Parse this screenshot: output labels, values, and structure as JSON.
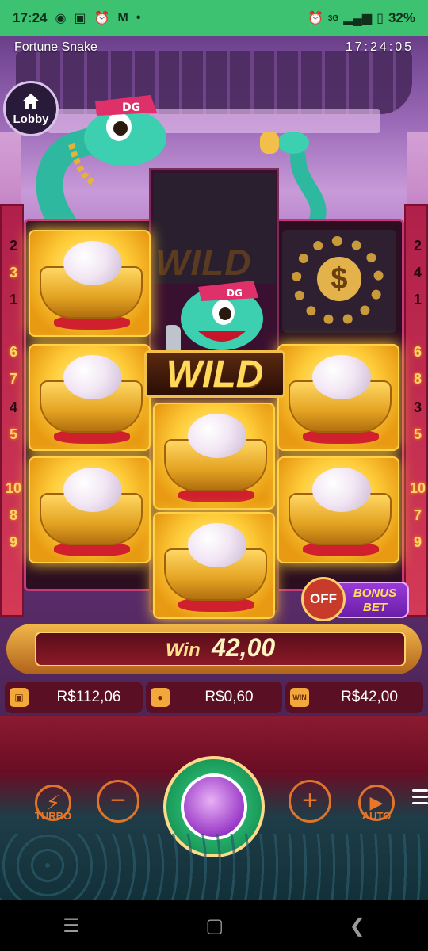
{
  "status_bar": {
    "time": "17:24",
    "left_icons": [
      "chat-icon",
      "s-app-icon",
      "alarm-icon",
      "gmail-icon",
      "dot-icon"
    ],
    "right_icons": [
      "alarm-icon",
      "signal-icon",
      "battery-icon"
    ],
    "network": "3G",
    "battery": "32%"
  },
  "game": {
    "title": "Fortune Snake",
    "clock": "17:24:05",
    "lobby_label": "Lobby",
    "wild_ghost_text": "WILD",
    "wild_text": "WILD",
    "chain_symbol_text": "$",
    "left_ways": [
      {
        "value": "2",
        "lit": false
      },
      {
        "value": "3",
        "lit": true
      },
      {
        "value": "1",
        "lit": false
      },
      {
        "value": "6",
        "lit": true
      },
      {
        "value": "7",
        "lit": true
      },
      {
        "value": "4",
        "lit": false
      },
      {
        "value": "5",
        "lit": true
      },
      {
        "value": "10",
        "lit": true
      },
      {
        "value": "8",
        "lit": true
      },
      {
        "value": "9",
        "lit": true
      }
    ],
    "right_ways": [
      {
        "value": "2",
        "lit": false
      },
      {
        "value": "4",
        "lit": false
      },
      {
        "value": "1",
        "lit": false
      },
      {
        "value": "6",
        "lit": true
      },
      {
        "value": "8",
        "lit": true
      },
      {
        "value": "3",
        "lit": false
      },
      {
        "value": "5",
        "lit": true
      },
      {
        "value": "10",
        "lit": true
      },
      {
        "value": "7",
        "lit": true
      },
      {
        "value": "9",
        "lit": true
      }
    ],
    "bonus_bet": {
      "toggle_label": "OFF",
      "label_line1": "BONUS",
      "label_line2": "BET"
    },
    "win": {
      "label": "Win",
      "value": "42,00"
    },
    "stats": {
      "balance": "R$112,06",
      "bet": "R$0,60",
      "win": "R$42,00",
      "win_icon_text": "WIN"
    },
    "controls": {
      "turbo_label": "TURBO",
      "auto_label": "AUTO",
      "minus_symbol": "−",
      "plus_symbol": "+"
    }
  },
  "colors": {
    "status_bar": "#3cc270",
    "accent_gold": "#ffd24a",
    "control_orange": "#e8762a",
    "reel_border": "#c8377a"
  }
}
